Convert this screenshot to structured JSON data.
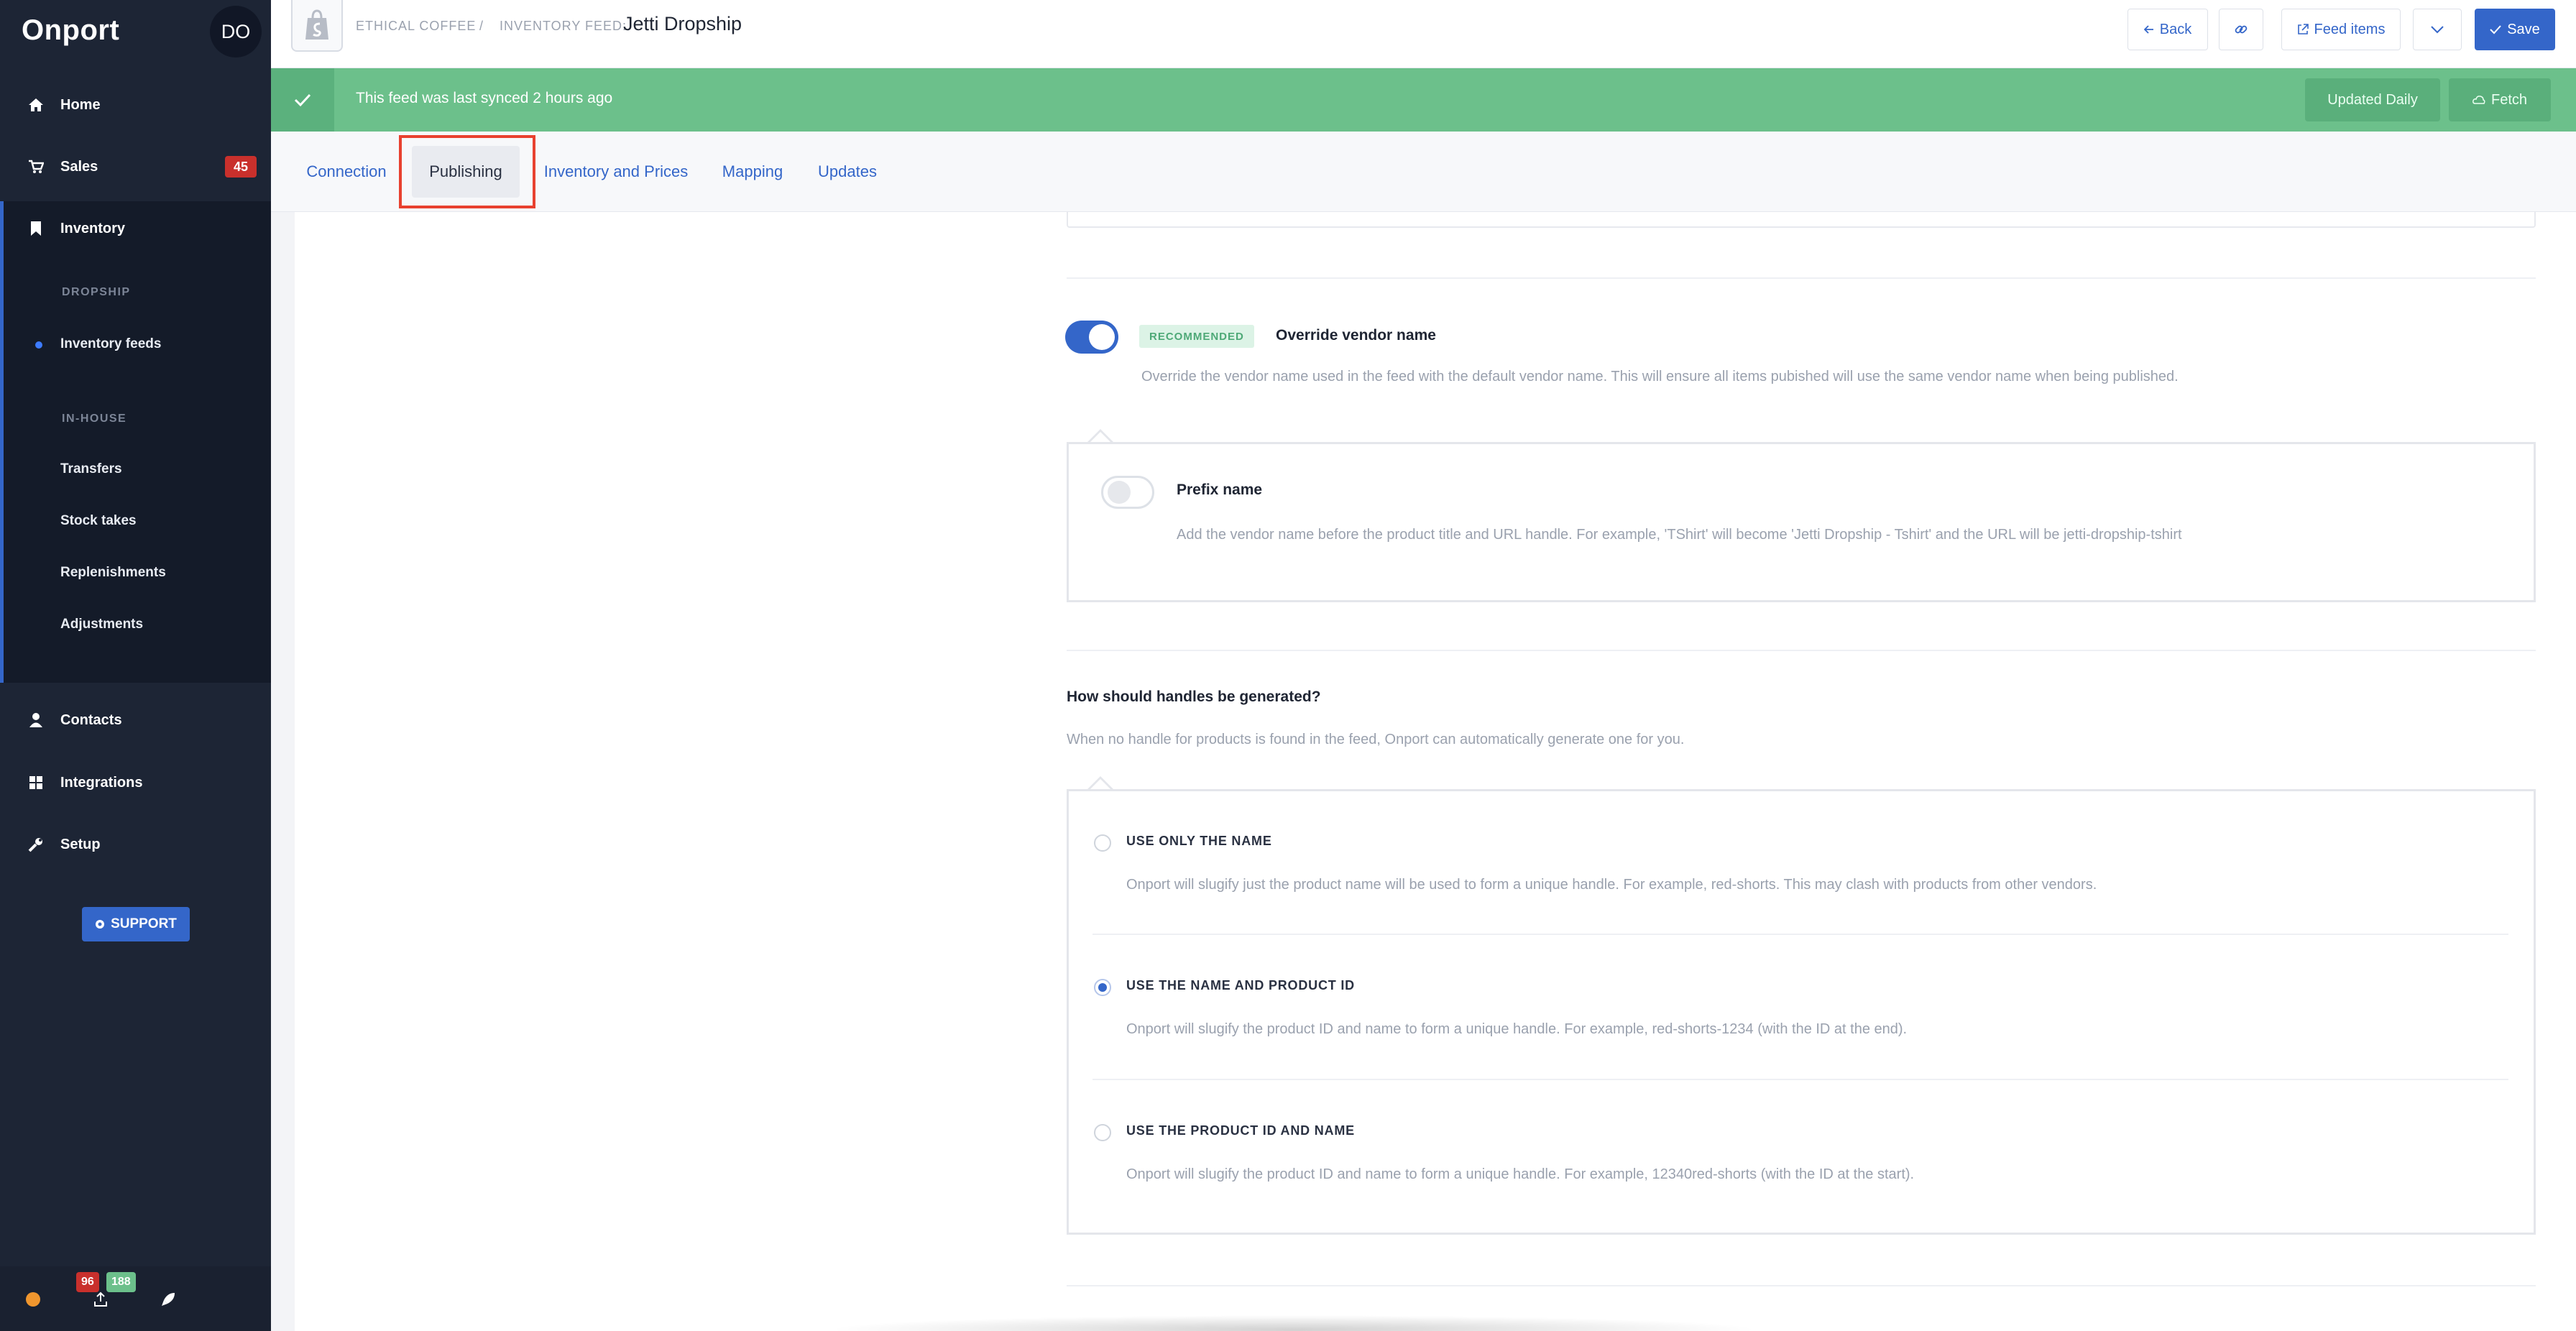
{
  "sidebar": {
    "brand": "Onport",
    "avatar": "DO",
    "nav": {
      "home": "Home",
      "sales": "Sales",
      "sales_badge": "45",
      "inventory": "Inventory",
      "contacts": "Contacts",
      "integrations": "Integrations",
      "setup": "Setup"
    },
    "dropship_heading": "DROPSHIP",
    "inventory_feeds": "Inventory feeds",
    "inhouse_heading": "IN-HOUSE",
    "inhouse_items": [
      "Transfers",
      "Stock takes",
      "Replenishments",
      "Adjustments"
    ],
    "support": "SUPPORT",
    "footer": {
      "badge_red": "96",
      "badge_green": "188"
    }
  },
  "header": {
    "breadcrumb_store": "ETHICAL COFFEE",
    "breadcrumb_sep": "/",
    "breadcrumb_label": "INVENTORY FEED:",
    "title": "Jetti Dropship",
    "back": "Back",
    "feed_items": "Feed items",
    "save": "Save"
  },
  "banner": {
    "text": "This feed was last synced 2 hours ago",
    "updated": "Updated Daily",
    "fetch": "Fetch"
  },
  "tabs": [
    "Connection",
    "Publishing",
    "Inventory and Prices",
    "Mapping",
    "Updates"
  ],
  "active_tab": "Publishing",
  "vendor": {
    "badge": "RECOMMENDED",
    "title": "Override vendor name",
    "desc": "Override the vendor name used in the feed with the default vendor name. This will ensure all items pubished will use the same vendor name when being published.",
    "enabled": true,
    "prefix_title": "Prefix name",
    "prefix_desc": "Add the vendor name before the product title and URL handle. For example, 'TShirt' will become 'Jetti Dropship - Tshirt' and the URL will be jetti-dropship-tshirt",
    "prefix_enabled": false
  },
  "handles": {
    "question": "How should handles be generated?",
    "desc": "When no handle for products is found in the feed, Onport can automatically generate one for you.",
    "options": [
      {
        "label": "USE ONLY THE NAME",
        "desc": "Onport will slugify just the product name will be used to form a unique handle. For example, red-shorts. This may clash with products from other vendors.",
        "checked": false
      },
      {
        "label": "USE THE NAME AND PRODUCT ID",
        "desc": "Onport will slugify the product ID and name to form a unique handle. For example, red-shorts-1234 (with the ID at the end).",
        "checked": true
      },
      {
        "label": "USE THE PRODUCT ID AND NAME",
        "desc": "Onport will slugify the product ID and name to form a unique handle. For example, 12340red-shorts (with the ID at the start).",
        "checked": false
      }
    ]
  },
  "colors": {
    "accent": "#3466c9",
    "success": "#6cc08b",
    "danger": "#c9302c",
    "sidebar": "#1d2535"
  }
}
